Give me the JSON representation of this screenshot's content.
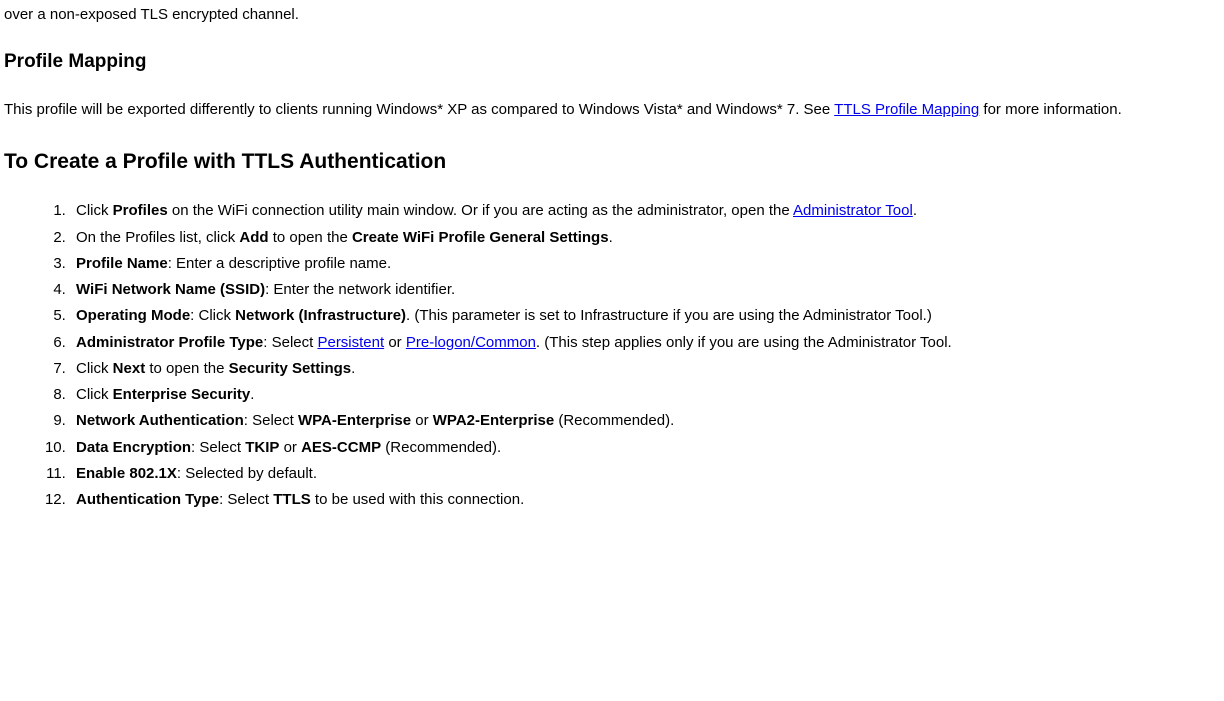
{
  "intro_line": "over a non-exposed TLS encrypted channel.",
  "section1_title": "Profile Mapping",
  "mapping_para_pre": "This profile will be exported differently to clients running Windows* XP as compared to Windows Vista* and Windows* 7. See ",
  "mapping_link": "TTLS Profile Mapping",
  "mapping_para_post": " for more information.",
  "section2_title": "To Create a Profile with TTLS Authentication",
  "steps": {
    "s1_a": "Click ",
    "s1_b": "Profiles",
    "s1_c": " on the WiFi connection utility main window. Or if you are acting as the administrator, open the ",
    "s1_link": "Administrator Tool",
    "s1_d": ".",
    "s2_a": "On the Profiles list, click ",
    "s2_b": "Add",
    "s2_c": " to open the ",
    "s2_d": "Create WiFi Profile General Settings",
    "s2_e": ".",
    "s3_a": "Profile Name",
    "s3_b": ": Enter a descriptive profile name.",
    "s4_a": "WiFi Network Name (SSID)",
    "s4_b": ": Enter the network identifier.",
    "s5_a": "Operating Mode",
    "s5_b": ": Click ",
    "s5_c": "Network (Infrastructure)",
    "s5_d": ". (This parameter is set to Infrastructure if you are using the Administrator Tool.)",
    "s6_a": "Administrator Profile Type",
    "s6_b": ": Select ",
    "s6_link1": "Persistent",
    "s6_c": " or ",
    "s6_link2": "Pre-logon/Common",
    "s6_d": ". (This step applies only if you are using the Administrator Tool.",
    "s7_a": "Click ",
    "s7_b": "Next",
    "s7_c": " to open the ",
    "s7_d": "Security Settings",
    "s7_e": ".",
    "s8_a": "Click ",
    "s8_b": "Enterprise Security",
    "s8_c": ".",
    "s9_a": "Network Authentication",
    "s9_b": ": Select ",
    "s9_c": "WPA-Enterprise",
    "s9_d": " or ",
    "s9_e": "WPA2-Enterprise",
    "s9_f": " (Recommended).",
    "s10_a": "Data Encryption",
    "s10_b": ": Select ",
    "s10_c": "TKIP",
    "s10_d": " or ",
    "s10_e": "AES-CCMP",
    "s10_f": " (Recommended).",
    "s11_a": "Enable 802.1X",
    "s11_b": ": Selected by default.",
    "s12_a": "Authentication Type",
    "s12_b": ": Select ",
    "s12_c": "TTLS",
    "s12_d": " to be used with this connection."
  }
}
